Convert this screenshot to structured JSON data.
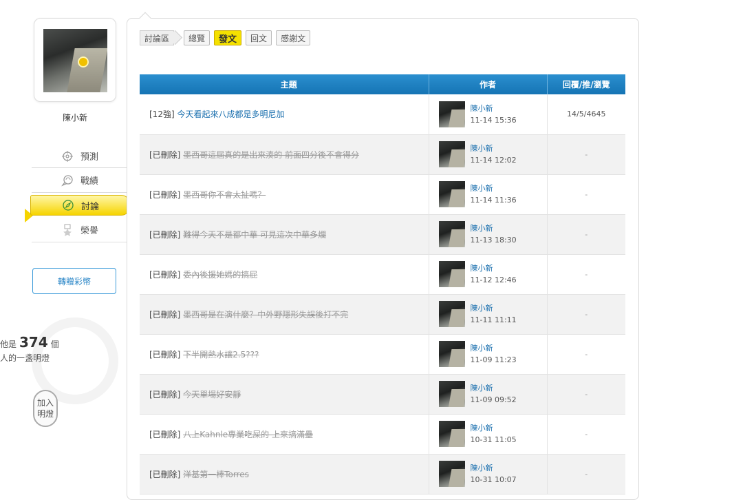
{
  "user": {
    "name": "陳小新"
  },
  "menu": [
    {
      "key": "predict",
      "label": "預測",
      "icon": "target-icon"
    },
    {
      "key": "record",
      "label": "戰績",
      "icon": "chat-bubble-icon"
    },
    {
      "key": "discuss",
      "label": "討論",
      "icon": "compass-icon",
      "active": true
    },
    {
      "key": "honor",
      "label": "榮譽",
      "icon": "medal-icon"
    }
  ],
  "gift_button": "轉贈彩幣",
  "bulb": {
    "prefix": "他是",
    "count": "374",
    "unit": "個",
    "line2": "人的一盞明燈",
    "join": "加入\n明燈"
  },
  "tabs": {
    "crumb": "討論區",
    "items": [
      {
        "label": "總覽"
      },
      {
        "label": "發文",
        "active": true
      },
      {
        "label": "回文"
      },
      {
        "label": "感謝文"
      }
    ]
  },
  "table": {
    "headers": {
      "topic": "主題",
      "author": "作者",
      "stats": "回覆/推/瀏覽"
    },
    "rows": [
      {
        "prefix": "[12強]",
        "title": "今天看起來八成都是多明尼加",
        "deleted": false,
        "author": "陳小新",
        "time": "11-14 15:36",
        "stats": "14/5/4645"
      },
      {
        "prefix": "[已刪除]",
        "title": "墨西哥這屆真的是出來湊的 前面四分後不會得分",
        "deleted": true,
        "author": "陳小新",
        "time": "11-14 12:02",
        "stats": "-"
      },
      {
        "prefix": "[已刪除]",
        "title": "墨西哥你不會太扯嗎？",
        "deleted": true,
        "author": "陳小新",
        "time": "11-14 11:36",
        "stats": "-"
      },
      {
        "prefix": "[已刪除]",
        "title": "難得今天不是都中華 可見這次中華多爛",
        "deleted": true,
        "author": "陳小新",
        "time": "11-13 18:30",
        "stats": "-"
      },
      {
        "prefix": "[已刪除]",
        "title": "委內後援她媽的搞屁",
        "deleted": true,
        "author": "陳小新",
        "time": "11-12 12:46",
        "stats": "-"
      },
      {
        "prefix": "[已刪除]",
        "title": "墨西哥是在演什麼？中外野隱形失誤後打不完",
        "deleted": true,
        "author": "陳小新",
        "time": "11-11 11:11",
        "stats": "-"
      },
      {
        "prefix": "[已刪除]",
        "title": "下半開熱水讓2.5???",
        "deleted": true,
        "author": "陳小新",
        "time": "11-09 11:23",
        "stats": "-"
      },
      {
        "prefix": "[已刪除]",
        "title": "今天單場好安靜",
        "deleted": true,
        "author": "陳小新",
        "time": "11-09 09:52",
        "stats": "-"
      },
      {
        "prefix": "[已刪除]",
        "title": "八上Kahnle專業吃屎的 上來搞滿壘",
        "deleted": true,
        "author": "陳小新",
        "time": "10-31 11:05",
        "stats": "-"
      },
      {
        "prefix": "[已刪除]",
        "title": "洋基第一棒Torres",
        "deleted": true,
        "author": "陳小新",
        "time": "10-31 10:07",
        "stats": "-"
      }
    ]
  }
}
